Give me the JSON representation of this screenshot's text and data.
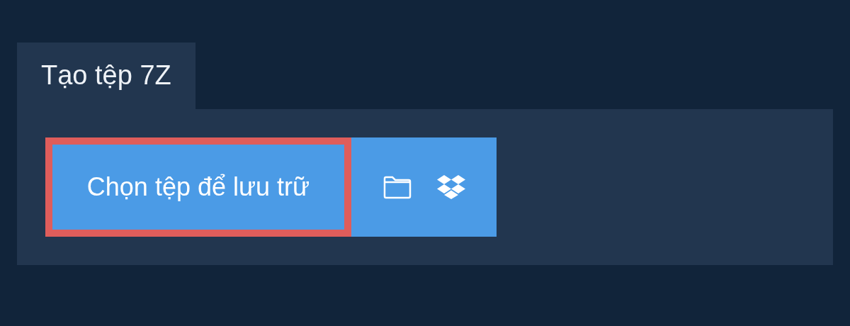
{
  "tab": {
    "label": "Tạo tệp 7Z",
    "selected": true
  },
  "button": {
    "label": "Chọn tệp để lưu trữ",
    "selected": true
  }
}
